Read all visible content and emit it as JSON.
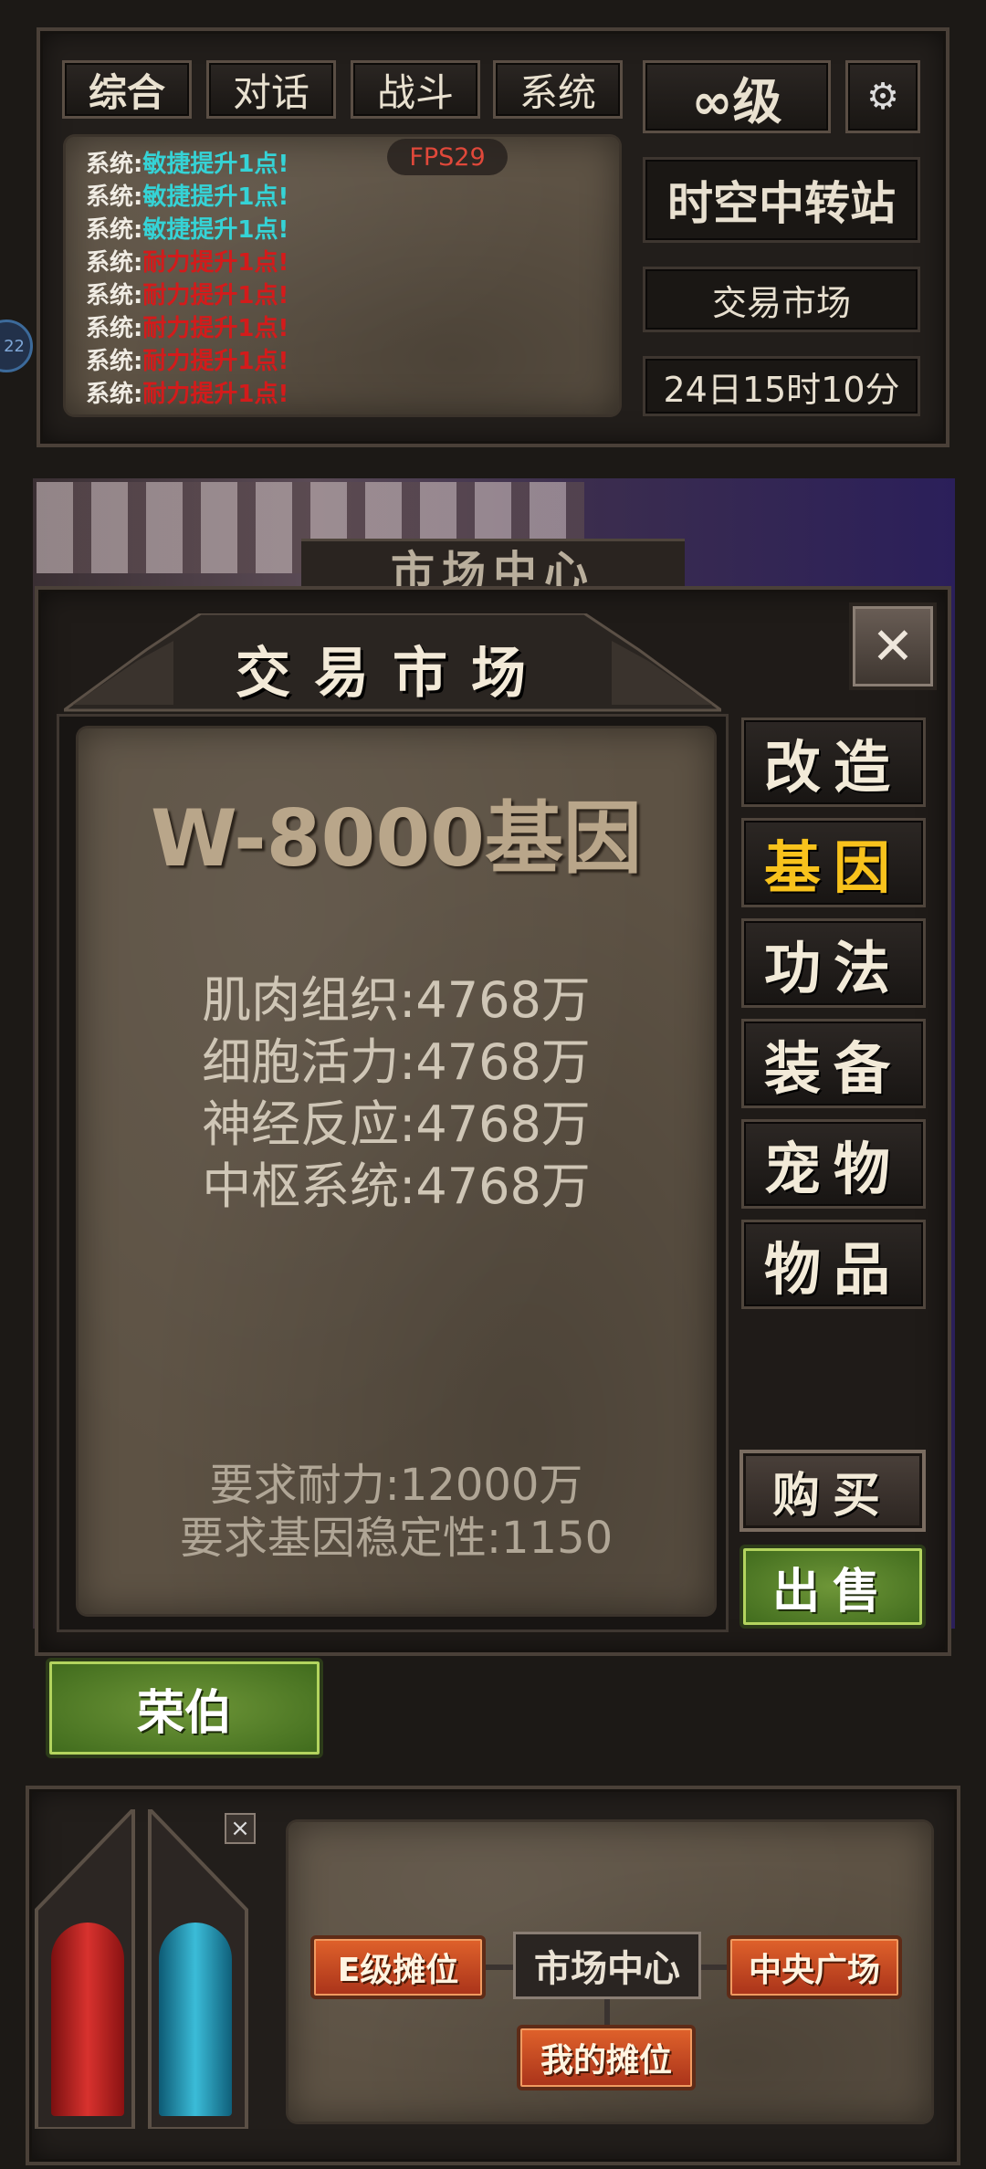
{
  "chat_tabs": [
    "综合",
    "对话",
    "战斗",
    "系统"
  ],
  "level_label": "∞级",
  "fps": "FPS29",
  "log": [
    {
      "prefix": "系统:",
      "text": "敏捷提升1点!",
      "color": "cyan"
    },
    {
      "prefix": "系统:",
      "text": "敏捷提升1点!",
      "color": "cyan"
    },
    {
      "prefix": "系统:",
      "text": "敏捷提升1点!",
      "color": "cyan"
    },
    {
      "prefix": "系统:",
      "text": "耐力提升1点!",
      "color": "red"
    },
    {
      "prefix": "系统:",
      "text": "耐力提升1点!",
      "color": "red"
    },
    {
      "prefix": "系统:",
      "text": "耐力提升1点!",
      "color": "red"
    },
    {
      "prefix": "系统:",
      "text": "耐力提升1点!",
      "color": "red"
    },
    {
      "prefix": "系统:",
      "text": "耐力提升1点!",
      "color": "red"
    }
  ],
  "side_badge": "22",
  "location": {
    "station": "时空中转站",
    "sub": "交易市场",
    "time": "24日15时10分"
  },
  "behind_title": "市场中心",
  "market": {
    "title": "交易市场",
    "close": "✕",
    "item_name": "W-8000基因",
    "stats": [
      "肌肉组织:4768万",
      "细胞活力:4768万",
      "神经反应:4768万",
      "中枢系统:4768万"
    ],
    "requirements": [
      "要求耐力:12000万",
      "要求基因稳定性:1150"
    ],
    "categories": [
      "改造",
      "基因",
      "功法",
      "装备",
      "宠物",
      "物品"
    ],
    "active_category": "基因",
    "buy_label": "购买",
    "sell_label": "出售"
  },
  "npc_button": "荣伯",
  "map": {
    "close": "×",
    "nodes": {
      "e_stall": "E级摊位",
      "center": "市场中心",
      "plaza": "中央广场",
      "my_stall": "我的摊位"
    }
  },
  "colors": {
    "active_tab": "#f8c21c",
    "hp": "#c42525",
    "mp": "#2aa3c4",
    "log_cyan": "#35d3d6",
    "log_red": "#d31b1b"
  }
}
